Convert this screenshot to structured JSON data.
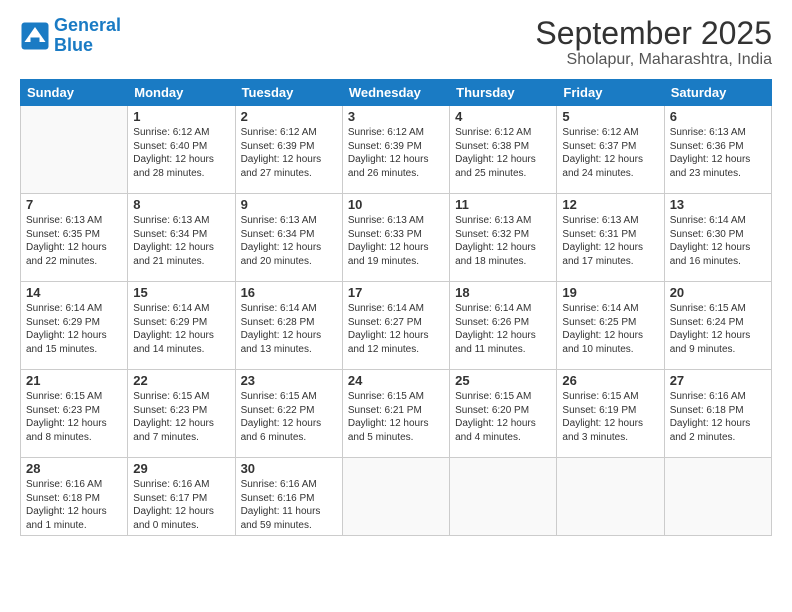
{
  "header": {
    "logo_line1": "General",
    "logo_line2": "Blue",
    "title": "September 2025",
    "subtitle": "Sholapur, Maharashtra, India"
  },
  "days_of_week": [
    "Sunday",
    "Monday",
    "Tuesday",
    "Wednesday",
    "Thursday",
    "Friday",
    "Saturday"
  ],
  "weeks": [
    [
      {
        "num": "",
        "info": ""
      },
      {
        "num": "1",
        "info": "Sunrise: 6:12 AM\nSunset: 6:40 PM\nDaylight: 12 hours\nand 28 minutes."
      },
      {
        "num": "2",
        "info": "Sunrise: 6:12 AM\nSunset: 6:39 PM\nDaylight: 12 hours\nand 27 minutes."
      },
      {
        "num": "3",
        "info": "Sunrise: 6:12 AM\nSunset: 6:39 PM\nDaylight: 12 hours\nand 26 minutes."
      },
      {
        "num": "4",
        "info": "Sunrise: 6:12 AM\nSunset: 6:38 PM\nDaylight: 12 hours\nand 25 minutes."
      },
      {
        "num": "5",
        "info": "Sunrise: 6:12 AM\nSunset: 6:37 PM\nDaylight: 12 hours\nand 24 minutes."
      },
      {
        "num": "6",
        "info": "Sunrise: 6:13 AM\nSunset: 6:36 PM\nDaylight: 12 hours\nand 23 minutes."
      }
    ],
    [
      {
        "num": "7",
        "info": "Sunrise: 6:13 AM\nSunset: 6:35 PM\nDaylight: 12 hours\nand 22 minutes."
      },
      {
        "num": "8",
        "info": "Sunrise: 6:13 AM\nSunset: 6:34 PM\nDaylight: 12 hours\nand 21 minutes."
      },
      {
        "num": "9",
        "info": "Sunrise: 6:13 AM\nSunset: 6:34 PM\nDaylight: 12 hours\nand 20 minutes."
      },
      {
        "num": "10",
        "info": "Sunrise: 6:13 AM\nSunset: 6:33 PM\nDaylight: 12 hours\nand 19 minutes."
      },
      {
        "num": "11",
        "info": "Sunrise: 6:13 AM\nSunset: 6:32 PM\nDaylight: 12 hours\nand 18 minutes."
      },
      {
        "num": "12",
        "info": "Sunrise: 6:13 AM\nSunset: 6:31 PM\nDaylight: 12 hours\nand 17 minutes."
      },
      {
        "num": "13",
        "info": "Sunrise: 6:14 AM\nSunset: 6:30 PM\nDaylight: 12 hours\nand 16 minutes."
      }
    ],
    [
      {
        "num": "14",
        "info": "Sunrise: 6:14 AM\nSunset: 6:29 PM\nDaylight: 12 hours\nand 15 minutes."
      },
      {
        "num": "15",
        "info": "Sunrise: 6:14 AM\nSunset: 6:29 PM\nDaylight: 12 hours\nand 14 minutes."
      },
      {
        "num": "16",
        "info": "Sunrise: 6:14 AM\nSunset: 6:28 PM\nDaylight: 12 hours\nand 13 minutes."
      },
      {
        "num": "17",
        "info": "Sunrise: 6:14 AM\nSunset: 6:27 PM\nDaylight: 12 hours\nand 12 minutes."
      },
      {
        "num": "18",
        "info": "Sunrise: 6:14 AM\nSunset: 6:26 PM\nDaylight: 12 hours\nand 11 minutes."
      },
      {
        "num": "19",
        "info": "Sunrise: 6:14 AM\nSunset: 6:25 PM\nDaylight: 12 hours\nand 10 minutes."
      },
      {
        "num": "20",
        "info": "Sunrise: 6:15 AM\nSunset: 6:24 PM\nDaylight: 12 hours\nand 9 minutes."
      }
    ],
    [
      {
        "num": "21",
        "info": "Sunrise: 6:15 AM\nSunset: 6:23 PM\nDaylight: 12 hours\nand 8 minutes."
      },
      {
        "num": "22",
        "info": "Sunrise: 6:15 AM\nSunset: 6:23 PM\nDaylight: 12 hours\nand 7 minutes."
      },
      {
        "num": "23",
        "info": "Sunrise: 6:15 AM\nSunset: 6:22 PM\nDaylight: 12 hours\nand 6 minutes."
      },
      {
        "num": "24",
        "info": "Sunrise: 6:15 AM\nSunset: 6:21 PM\nDaylight: 12 hours\nand 5 minutes."
      },
      {
        "num": "25",
        "info": "Sunrise: 6:15 AM\nSunset: 6:20 PM\nDaylight: 12 hours\nand 4 minutes."
      },
      {
        "num": "26",
        "info": "Sunrise: 6:15 AM\nSunset: 6:19 PM\nDaylight: 12 hours\nand 3 minutes."
      },
      {
        "num": "27",
        "info": "Sunrise: 6:16 AM\nSunset: 6:18 PM\nDaylight: 12 hours\nand 2 minutes."
      }
    ],
    [
      {
        "num": "28",
        "info": "Sunrise: 6:16 AM\nSunset: 6:18 PM\nDaylight: 12 hours\nand 1 minute."
      },
      {
        "num": "29",
        "info": "Sunrise: 6:16 AM\nSunset: 6:17 PM\nDaylight: 12 hours\nand 0 minutes."
      },
      {
        "num": "30",
        "info": "Sunrise: 6:16 AM\nSunset: 6:16 PM\nDaylight: 11 hours\nand 59 minutes."
      },
      {
        "num": "",
        "info": ""
      },
      {
        "num": "",
        "info": ""
      },
      {
        "num": "",
        "info": ""
      },
      {
        "num": "",
        "info": ""
      }
    ]
  ]
}
